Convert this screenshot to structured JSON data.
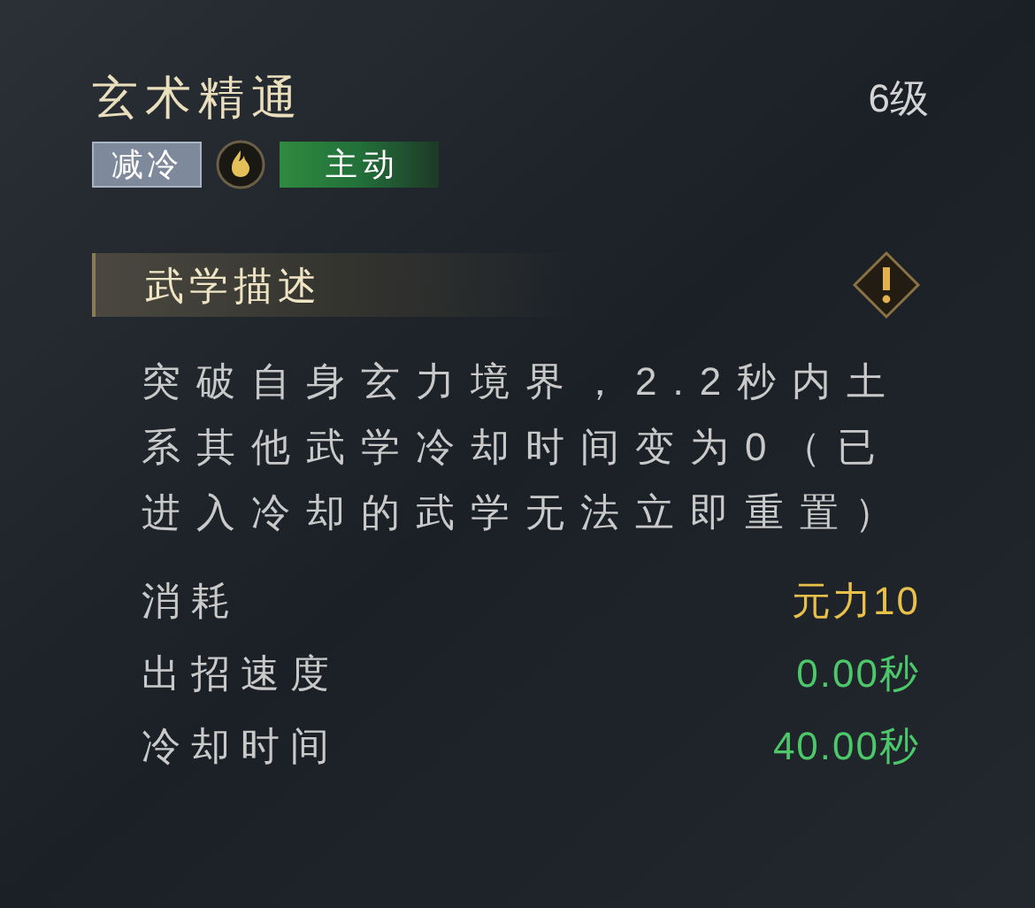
{
  "skill": {
    "name": "玄术精通",
    "level": "6级"
  },
  "tags": [
    {
      "kind": "tag",
      "label": "减冷"
    },
    {
      "kind": "element"
    },
    {
      "kind": "active",
      "label": "主动"
    }
  ],
  "section": {
    "title": "武学描述"
  },
  "description": "突破自身玄力境界，2.2秒内土系其他武学冷却时间变为0（已进入冷却的武学无法立即重置）",
  "stats": [
    {
      "label": "消耗",
      "value": "元力10",
      "color": "#e8c04a"
    },
    {
      "label": "出招速度",
      "value": "0.00秒",
      "color": "#4cc76a"
    },
    {
      "label": "冷却时间",
      "value": "40.00秒",
      "color": "#4cc76a"
    }
  ]
}
